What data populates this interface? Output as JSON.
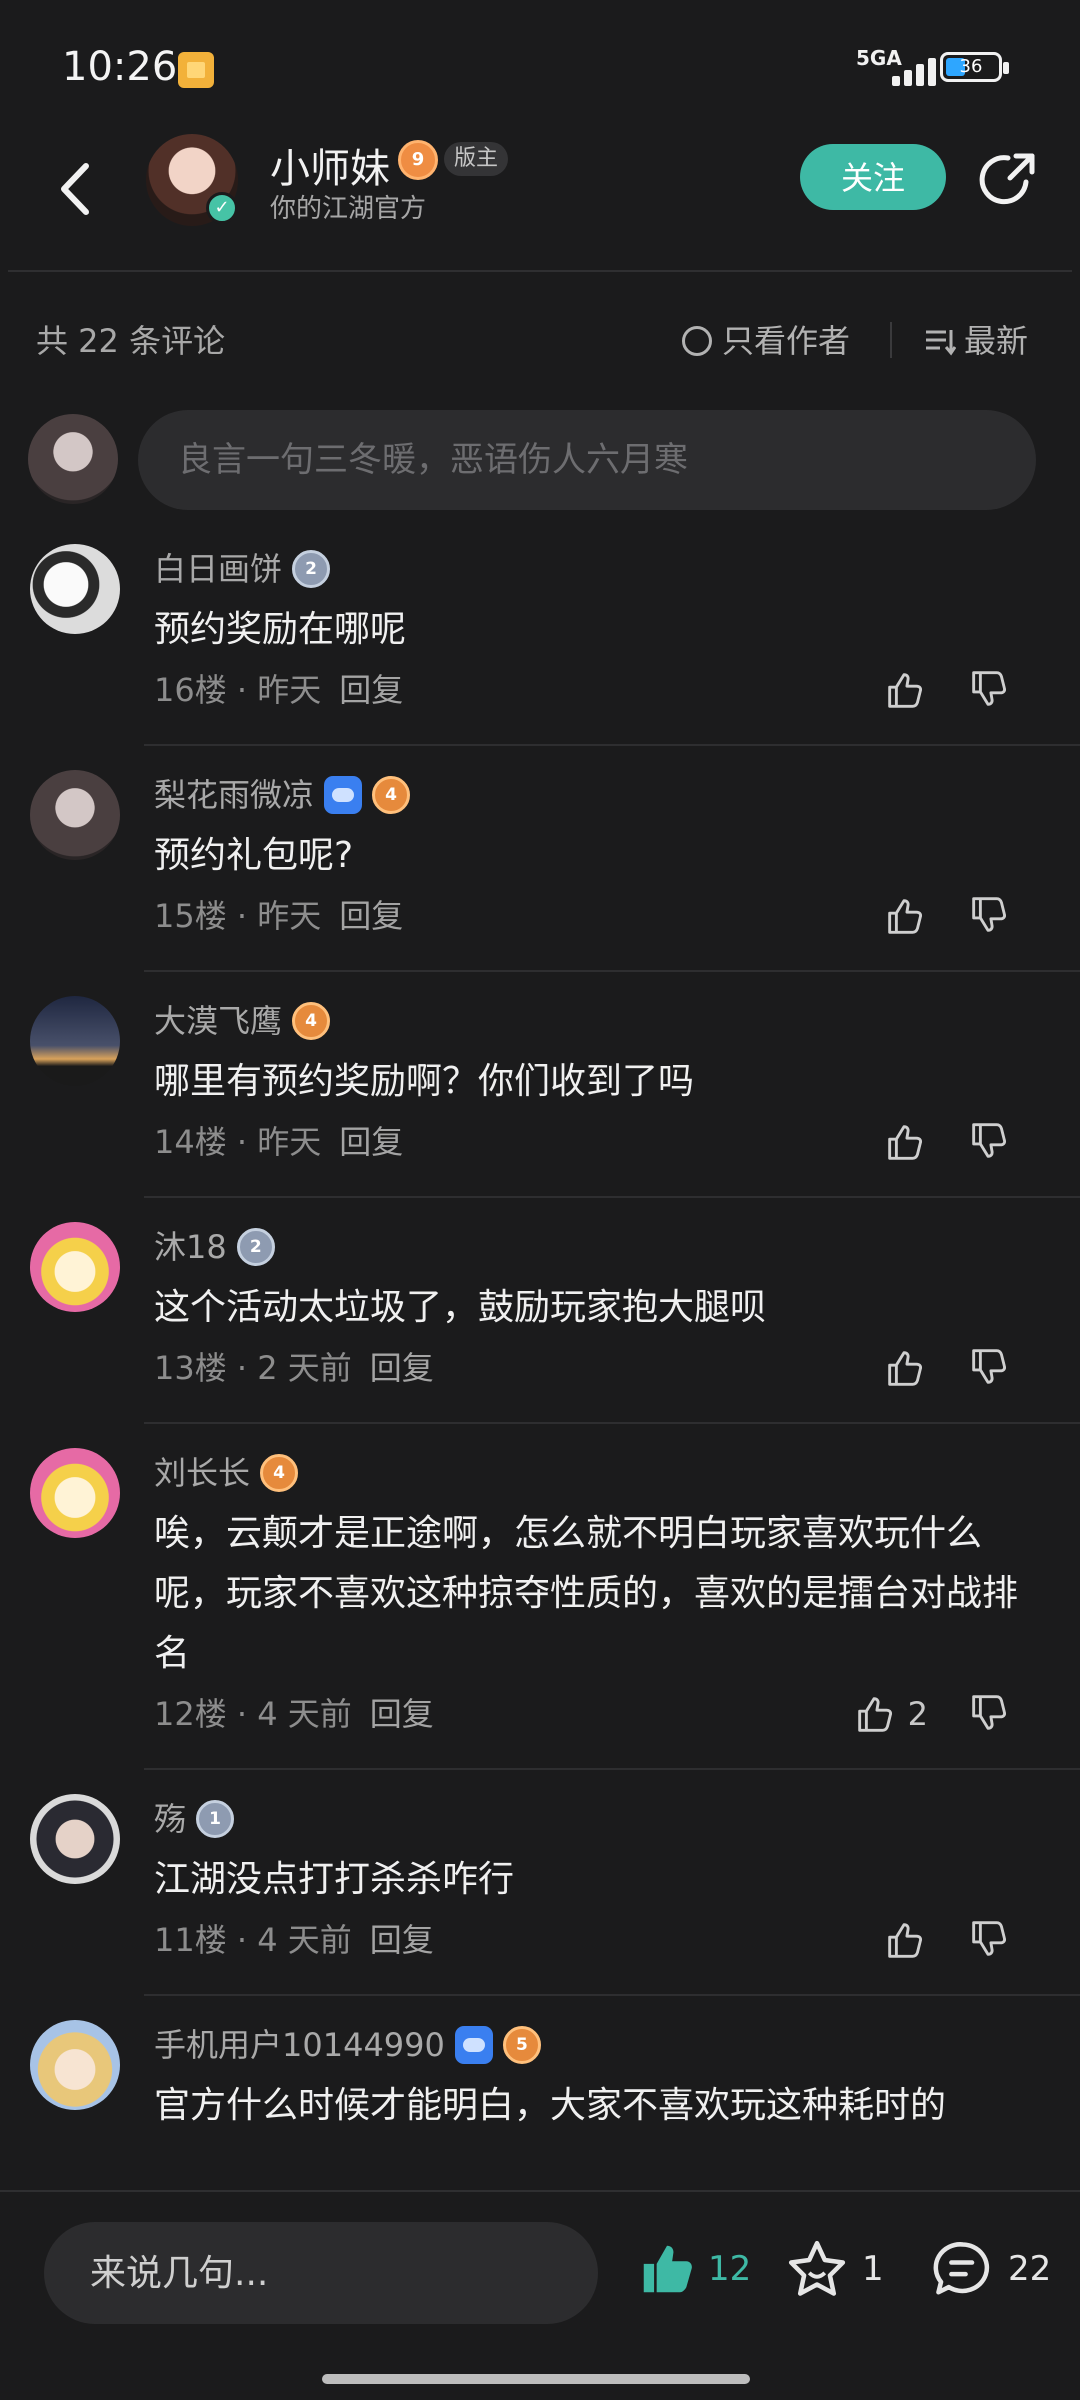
{
  "status_bar": {
    "time": "10:26",
    "network": "5GA",
    "battery": "36"
  },
  "header": {
    "author_name": "小师妹",
    "author_level": "9",
    "mod_badge": "版主",
    "author_subtitle": "你的江湖官方",
    "follow_label": "关注"
  },
  "sort_bar": {
    "comment_count": "共 22 条评论",
    "author_only": "只看作者",
    "latest": "最新"
  },
  "compose": {
    "placeholder": "良言一句三冬暖，恶语伤人六月寒"
  },
  "comments": [
    {
      "name": "白日画饼",
      "level": "2",
      "level_style": "silver",
      "game_badge": false,
      "text": "预约奖励在哪呢",
      "floor": "16楼",
      "time": "昨天",
      "reply": "回复",
      "likes": ""
    },
    {
      "name": "梨花雨微凉",
      "level": "4",
      "level_style": "gold",
      "game_badge": true,
      "text": "预约礼包呢?",
      "floor": "15楼",
      "time": "昨天",
      "reply": "回复",
      "likes": ""
    },
    {
      "name": "大漠飞鹰",
      "level": "4",
      "level_style": "gold",
      "game_badge": false,
      "text": "哪里有预约奖励啊？你们收到了吗",
      "floor": "14楼",
      "time": "昨天",
      "reply": "回复",
      "likes": ""
    },
    {
      "name": "沐18",
      "level": "2",
      "level_style": "silver",
      "game_badge": false,
      "text": "这个活动太垃圾了，鼓励玩家抱大腿呗",
      "floor": "13楼",
      "time": "2 天前",
      "reply": "回复",
      "likes": ""
    },
    {
      "name": "刘长长",
      "level": "4",
      "level_style": "gold",
      "game_badge": false,
      "text": "唉，云颠才是正途啊，怎么就不明白玩家喜欢玩什么呢，玩家不喜欢这种掠夺性质的，喜欢的是擂台对战排名",
      "floor": "12楼",
      "time": "4 天前",
      "reply": "回复",
      "likes": "2"
    },
    {
      "name": "殇",
      "level": "1",
      "level_style": "silver",
      "game_badge": false,
      "text": "江湖没点打打杀杀咋行",
      "floor": "11楼",
      "time": "4 天前",
      "reply": "回复",
      "likes": ""
    },
    {
      "name": "手机用户10144990",
      "level": "5",
      "level_style": "gold",
      "game_badge": true,
      "text": "官方什么时候才能明白，大家不喜欢玩这种耗时的",
      "floor": "",
      "time": "",
      "reply": "",
      "likes": ""
    }
  ],
  "bottom_bar": {
    "input_placeholder": "来说几句...",
    "like_count": "12",
    "fav_count": "1",
    "comment_count": "22"
  },
  "colors": {
    "background": "#1b1b1c",
    "accent": "#3eb9a5"
  },
  "icons": [
    "back-icon",
    "share-icon",
    "thumb-up-icon",
    "thumb-down-icon",
    "star-icon",
    "comment-icon",
    "sort-icon",
    "verified-icon"
  ]
}
